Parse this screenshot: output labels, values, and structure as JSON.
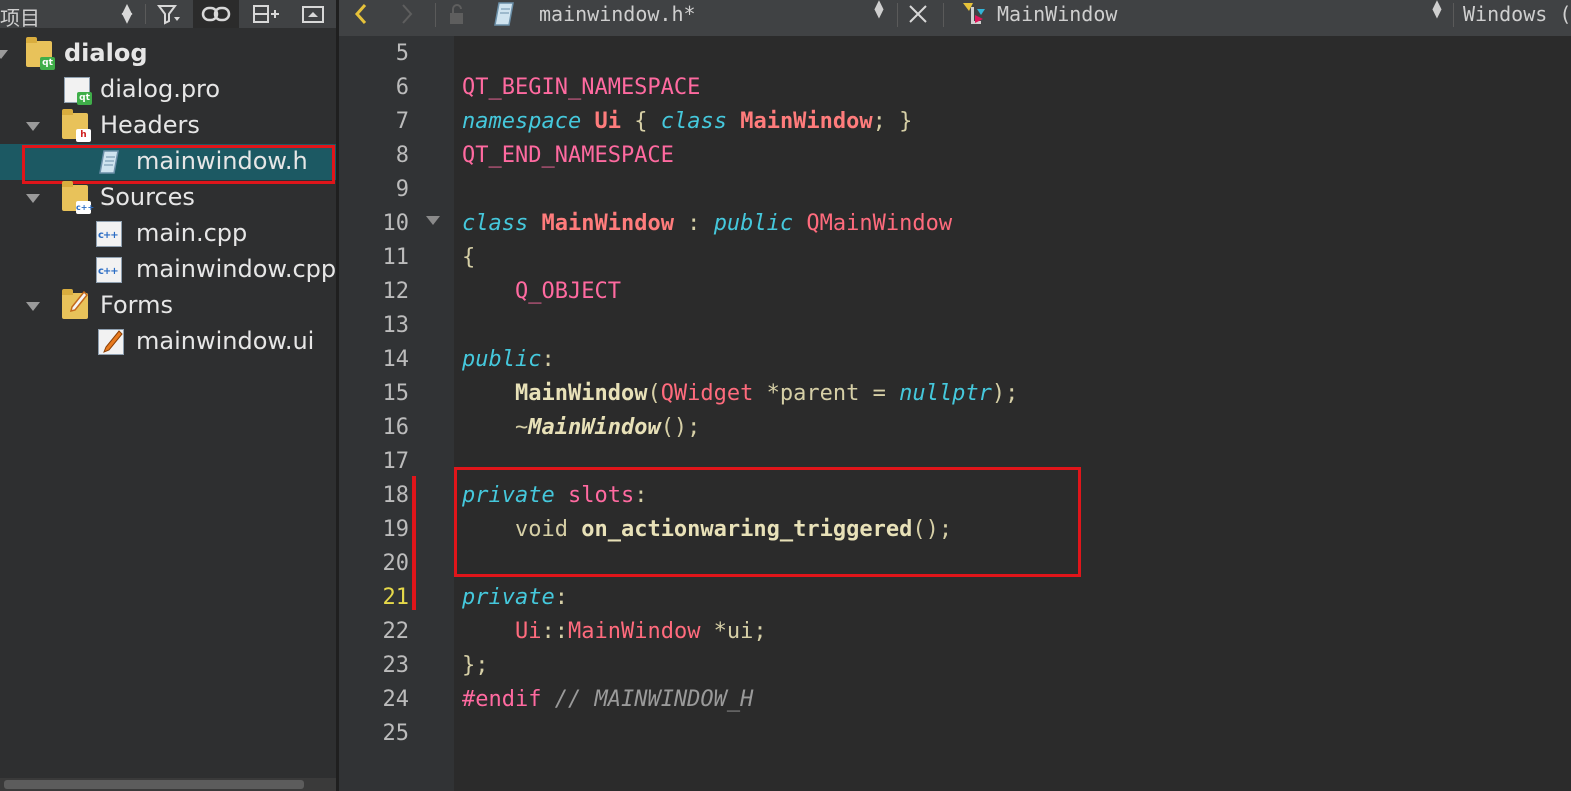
{
  "left_panel": {
    "title": "项目",
    "tree": [
      {
        "label": "dialog",
        "icon": "qt-project-folder-icon",
        "bold": true
      },
      {
        "label": "dialog.pro",
        "icon": "qt-pro-file-icon"
      },
      {
        "label": "Headers",
        "icon": "headers-folder-icon"
      },
      {
        "label": "mainwindow.h",
        "icon": "header-file-icon",
        "selected": true
      },
      {
        "label": "Sources",
        "icon": "sources-folder-icon"
      },
      {
        "label": "main.cpp",
        "icon": "cpp-file-icon"
      },
      {
        "label": "mainwindow.cpp",
        "icon": "cpp-file-icon"
      },
      {
        "label": "Forms",
        "icon": "forms-folder-icon"
      },
      {
        "label": "mainwindow.ui",
        "icon": "ui-file-icon"
      }
    ]
  },
  "editor": {
    "file_tab": "mainwindow.h*",
    "symbol": "MainWindow",
    "line_ending": "Windows (",
    "current_line": "21",
    "line_numbers": [
      "5",
      "6",
      "7",
      "8",
      "9",
      "10",
      "11",
      "12",
      "13",
      "14",
      "15",
      "16",
      "17",
      "18",
      "19",
      "20",
      "21",
      "22",
      "23",
      "24",
      "25"
    ]
  },
  "colors": {
    "highlight_border": "#e0151a",
    "selection_bg": "#1c5963",
    "keyword": "#45c8dc",
    "macro": "#ff6aa0",
    "type": "#ff6b7d",
    "current_line_number": "#e6d94a"
  }
}
